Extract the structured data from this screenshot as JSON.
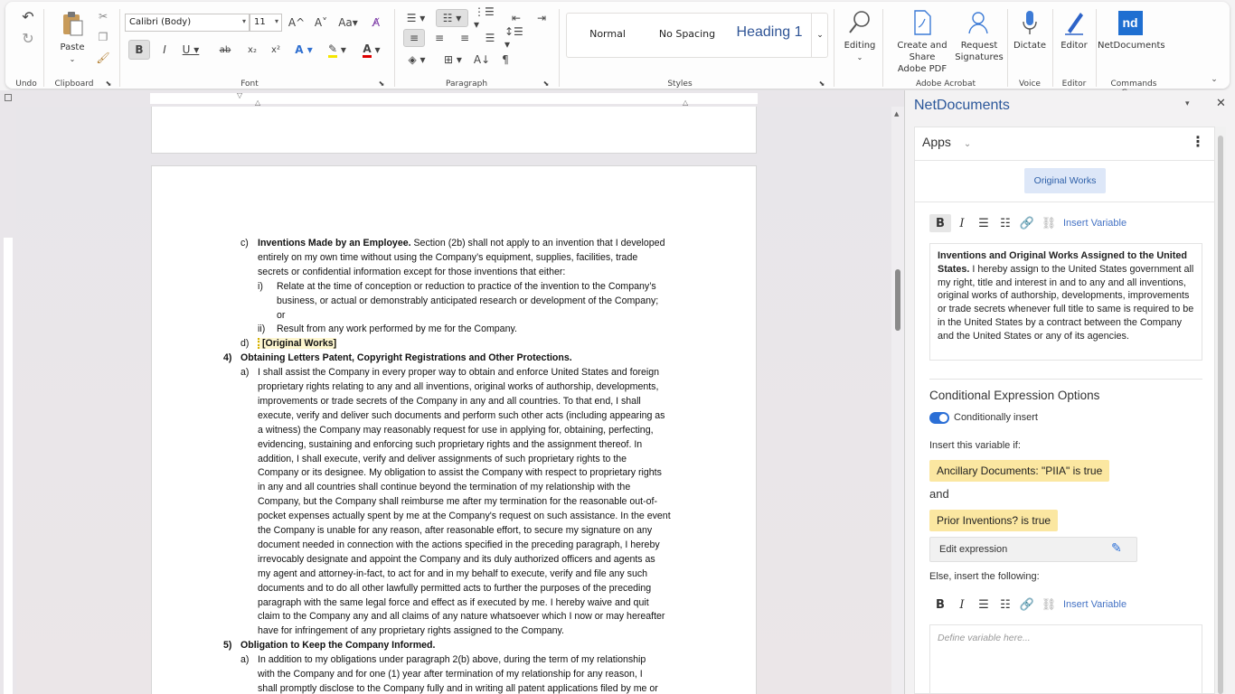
{
  "ribbon": {
    "undo_group": "Undo",
    "clipboard": {
      "paste": "Paste",
      "group": "Clipboard"
    },
    "font": {
      "name": "Calibri (Body)",
      "size": "11",
      "group": "Font",
      "grow": "A^",
      "shrink": "A˅",
      "change_case": "Aa",
      "bold": "B",
      "italic": "I",
      "underline": "U",
      "strike": "ab",
      "subscript": "x₂",
      "superscript": "x²"
    },
    "paragraph": {
      "group": "Paragraph"
    },
    "styles": {
      "group": "Styles",
      "items": [
        "Normal",
        "No Spacing",
        "Heading 1"
      ]
    },
    "editing": "Editing",
    "adobe": {
      "create_share": "Create and Share Adobe PDF",
      "create_share_l1": "Create and Share",
      "create_share_l2": "Adobe PDF",
      "request_sig_l1": "Request",
      "request_sig_l2": "Signatures",
      "group": "Adobe Acrobat"
    },
    "voice": {
      "dictate": "Dictate",
      "group": "Voice"
    },
    "editor": {
      "label": "Editor",
      "group": "Editor"
    },
    "nd": {
      "label": "NetDocuments",
      "group": "Commands Group",
      "logo": "nd"
    }
  },
  "document": {
    "lines": [
      {
        "marker": "c)",
        "bold": "Inventions Made by an Employee.",
        "text": " Section (2b) shall not apply to an invention that I developed"
      },
      {
        "text": "entirely on my own time without using the Company’s equipment, supplies, facilities, trade"
      },
      {
        "text": "secrets or confidential information except for those inventions that either:"
      },
      {
        "marker": "i)",
        "text": "Relate at the time of conception or reduction to practice of the invention to the Company’s"
      },
      {
        "text": "business, or actual or demonstrably anticipated research or development of the Company;"
      },
      {
        "text": "or"
      },
      {
        "marker": "ii)",
        "text": "Result from any work performed by me for the Company."
      },
      {
        "marker": "d)",
        "bold": "[Original Works]"
      },
      {
        "marker": "4)",
        "bold": "Obtaining Letters Patent, Copyright Registrations and Other Protections."
      },
      {
        "marker": "a)",
        "text": "I shall assist the Company in every proper way to obtain and enforce United States and foreign"
      },
      {
        "text": "proprietary rights relating to any and all inventions, original works of authorship, developments,"
      },
      {
        "text": "improvements or trade secrets of the Company in any and all countries. To that end, I shall"
      },
      {
        "text": "execute, verify and deliver such documents and perform such other acts (including appearing as"
      },
      {
        "text": "a witness) the Company may reasonably request for use in applying for, obtaining, perfecting,"
      },
      {
        "text": "evidencing, sustaining and enforcing such proprietary rights and the assignment thereof. In"
      },
      {
        "text": "addition, I shall execute, verify and deliver assignments of such proprietary rights to the"
      },
      {
        "text": "Company or its designee. My obligation to assist the Company with respect to proprietary rights"
      },
      {
        "text": "in any and all countries shall continue beyond the termination of my relationship with the"
      },
      {
        "text": "Company, but the Company shall reimburse me after my termination for the reasonable out-of-"
      },
      {
        "text": "pocket expenses actually spent by me at the Company's request on such assistance. In the event"
      },
      {
        "text": "the Company is unable for any reason, after reasonable effort, to secure my signature on any"
      },
      {
        "text": "document needed in connection with the actions specified in the preceding paragraph, I hereby"
      },
      {
        "text": "irrevocably designate and appoint the Company and its duly authorized officers and agents as"
      },
      {
        "text": "my agent and attorney-in-fact, to act for and in my behalf to execute, verify and file any such"
      },
      {
        "text": "documents and to do all other lawfully permitted acts to further the purposes of the preceding"
      },
      {
        "text": "paragraph with the same legal force and effect as if executed by me. I hereby waive and quit"
      },
      {
        "text": "claim to the Company any and all claims of any nature whatsoever which I now or may hereafter"
      },
      {
        "text": "have for infringement of any proprietary rights assigned to the Company."
      },
      {
        "marker": "5)",
        "bold": "Obligation to Keep the Company Informed."
      },
      {
        "marker": "a)",
        "text": "In addition to my obligations under paragraph 2(b) above, during the term of my relationship"
      },
      {
        "text": "with the Company and for one (1) year after termination of my relationship for any reason, I"
      },
      {
        "text": "shall promptly disclose to the Company fully and in writing all patent applications filed by me or"
      }
    ]
  },
  "pane": {
    "title": "NetDocuments",
    "apps_label": "Apps",
    "variable_chip": "Original Works",
    "insert_variable": "Insert Variable",
    "content_bold": "Inventions and Original Works Assigned to the United States.",
    "content_text": " I hereby assign to the United States government all my right, title and interest in and to any and all inventions, original works of authorship, developments, improvements or trade secrets whenever full title to same is required to be in the United States by a contract between the Company and the United States or any of its agencies.",
    "cond_heading": "Conditional Expression Options",
    "toggle_label": "Conditionally insert",
    "insert_if": "Insert this variable if:",
    "condition1": "Ancillary Documents: \"PIIA\" is true",
    "and": "and",
    "condition2": "Prior Inventions? is true",
    "edit_expression": "Edit expression",
    "else_label": "Else, insert the following:",
    "else_placeholder": "Define variable here..."
  },
  "colors": {
    "accent": "#2b579a",
    "highlight": "#fbe7a1",
    "toggle": "#2b6fd6"
  }
}
